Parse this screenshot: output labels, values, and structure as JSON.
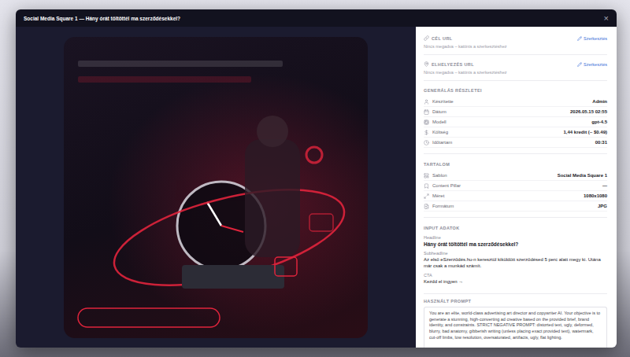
{
  "window": {
    "title": "Social Media Square 1 — Hány órát töltöttél ma szerződésekkel?",
    "close": "×"
  },
  "url_fields": [
    {
      "label": "CÉL URL",
      "action": "Szerkesztés",
      "value": "Nincs megadva – kattints a szerkesztéshez"
    },
    {
      "label": "ELHELYEZÉS URL",
      "action": "Szerkesztés",
      "value": "Nincs megadva – kattints a szerkesztéshez"
    }
  ],
  "generation": {
    "title": "GENERÁLÁS RÉSZLETEI",
    "rows": [
      {
        "label": "Készítette",
        "value": "Admin"
      },
      {
        "label": "Dátum",
        "value": "2026.05.15 02:55"
      },
      {
        "label": "Modell",
        "value": "gpt-4.5"
      },
      {
        "label": "Költség",
        "value": "1,44 kredit (~ $0.49)"
      },
      {
        "label": "Időtartam",
        "value": "00:31"
      }
    ]
  },
  "content": {
    "title": "TARTALOM",
    "rows": [
      {
        "label": "Sablon",
        "value": "Social Media Square 1"
      },
      {
        "label": "Content Pillar",
        "value": "—"
      },
      {
        "label": "Méret",
        "value": "1080x1080"
      },
      {
        "label": "Formátum",
        "value": "JPG"
      }
    ]
  },
  "inputs": {
    "title": "INPUT ADATOK",
    "fields": [
      {
        "label": "Headline",
        "value": "Hány órát töltöttél ma szerződésekkel?"
      },
      {
        "label": "Subheadline",
        "value": "Az első eSzerződés.hu-n keresztül kiküldött szerződésed 5 perc alatt megy ki. Utána már csak a munkád számít."
      },
      {
        "label": "CTA",
        "value": "Kezdd el ingyen →"
      }
    ]
  },
  "prompt": {
    "title": "HASZNÁLT PROMPT",
    "text": "You are an elite, world-class advertising art director and copywriter AI. Your objective is to generate a stunning, high-converting ad creative based on the provided brief, brand identity, and constraints. STRICT NEGATIVE PROMPT: distorted text, ugly, deformed, blurry, bad anatomy, gibberish writing (unless placing exact provided text), watermark, cut-off limbs, low resolution, oversaturated, artifacts, ugly, flat lighting."
  }
}
